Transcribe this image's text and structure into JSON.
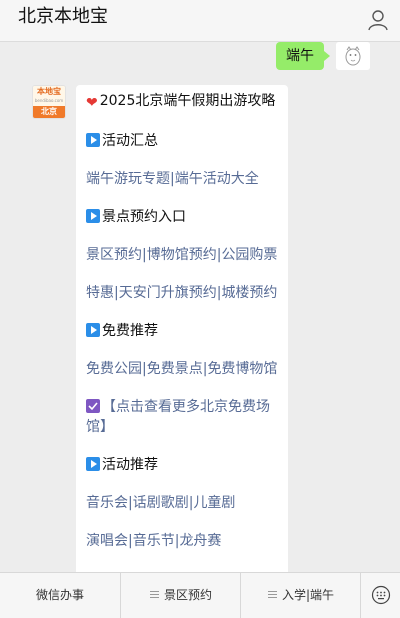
{
  "header": {
    "title": "北京本地宝",
    "user_icon": "user-icon"
  },
  "outgoing": {
    "text": "端午"
  },
  "incoming": {
    "avatar_logo_text": "本地宝",
    "avatar_logo_sub": "bendibao.com",
    "avatar_city": "北京",
    "lines": {
      "title": "2025北京端午假期出游攻略",
      "section1": "活动汇总",
      "s1_link1": "端午游玩专题",
      "s1_link2": "端午活动大全",
      "section2": "景点预约入口",
      "s2_link1": "景区预约",
      "s2_link2": "博物馆预约",
      "s2_link3": "公园购票",
      "s2_link4": "特惠",
      "s2_link5": "天安门升旗预约",
      "s2_link6": "城楼预约",
      "section3": "免费推荐",
      "s3_link1": "免费公园",
      "s3_link2": "免费景点",
      "s3_link3": "免费博物馆",
      "more_link": "【点击查看更多北京免费场馆】",
      "section4": "活动推荐",
      "s4_link1": "音乐会",
      "s4_link2": "话剧歌剧",
      "s4_link3": "儿童剧",
      "s4_link4": "演唱会",
      "s4_link5": "音乐节",
      "s4_link6": "龙舟赛",
      "sep": "|"
    }
  },
  "bottom_bar": {
    "tab1": "微信办事",
    "tab2": "景区预约",
    "tab3": "入学|端午",
    "keyboard_icon": "keyboard-icon"
  }
}
